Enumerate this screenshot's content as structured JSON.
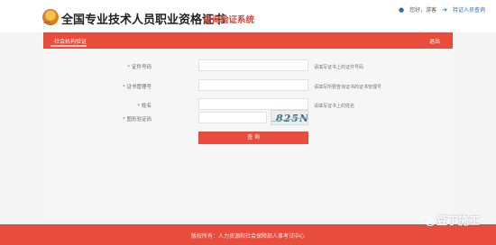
{
  "header": {
    "logo_text": "OSTA",
    "title_main": "全国专业技术人员职业资格证书",
    "title_sub": "查询验证系统",
    "greeting": "您好，游客",
    "special_link": "持证人员查询"
  },
  "nav": {
    "tab_label": "社会机构验证",
    "exit_label": "退出"
  },
  "form": {
    "fields": [
      {
        "label": "证件号码",
        "hint": "请填写证书上的证件号码",
        "value": ""
      },
      {
        "label": "证书管理号",
        "hint": "请填写所要查询证书的证书管理号",
        "value": ""
      },
      {
        "label": "姓名",
        "hint": "请填写证书上的姓名",
        "value": ""
      }
    ],
    "captcha_label": "图形验证码",
    "captcha_text": "825N",
    "captcha_value": "",
    "submit_label": "查 询"
  },
  "footer": {
    "text": "版权所有：人力资源和社会保障部人事考试中心"
  },
  "watermark": {
    "text": "豆丁施工"
  },
  "colors": {
    "accent": "#e84c3d",
    "title_sub": "#d9443a"
  }
}
